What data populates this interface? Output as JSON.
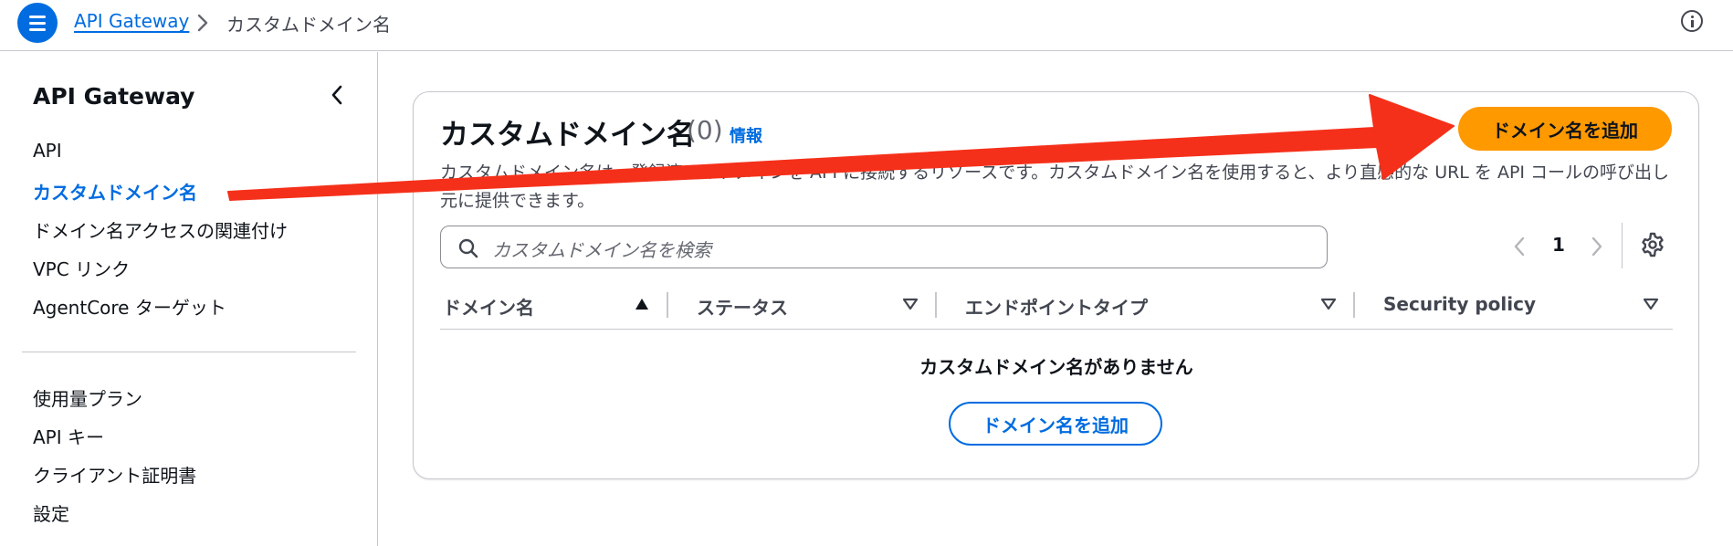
{
  "topbar": {
    "menu_icon": "hamburger-menu-icon",
    "breadcrumb_link": "API Gateway",
    "breadcrumb_current": "カスタムドメイン名",
    "info_icon": "info-icon"
  },
  "sidebar": {
    "title": "API Gateway",
    "collapse_icon": "chevron-left-icon",
    "items": [
      {
        "label": "API"
      },
      {
        "label": "カスタムドメイン名"
      },
      {
        "label": "ドメイン名アクセスの関連付け"
      },
      {
        "label": "VPC リンク"
      },
      {
        "label": "AgentCore ターゲット"
      },
      {
        "label": "使用量プラン"
      },
      {
        "label": "API キー"
      },
      {
        "label": "クライアント証明書"
      },
      {
        "label": "設定"
      }
    ],
    "active_index": 1
  },
  "panel": {
    "title": "カスタムドメイン名",
    "count": "(0)",
    "info_link": "情報",
    "description": "カスタムドメイン名は、登録済みのドメインを API に接続するリソースです。カスタムドメイン名を使用すると、より直感的な URL を API コールの呼び出し元に提供できます。",
    "primary_button": "ドメイン名を追加",
    "search_placeholder": "カスタムドメイン名を検索",
    "pagination": {
      "current_page": "1"
    },
    "columns": [
      {
        "label": "ドメイン名",
        "sort": "ascending"
      },
      {
        "label": "ステータス",
        "sort": "none"
      },
      {
        "label": "エンドポイントタイプ",
        "sort": "none"
      },
      {
        "label": "Security policy",
        "sort": "none"
      }
    ],
    "empty_title": "カスタムドメイン名がありません",
    "empty_button": "ドメイン名を追加"
  },
  "colors": {
    "accent": "#006ce0",
    "primary_button": "#ff9900",
    "annotation_arrow": "#f5301a"
  }
}
